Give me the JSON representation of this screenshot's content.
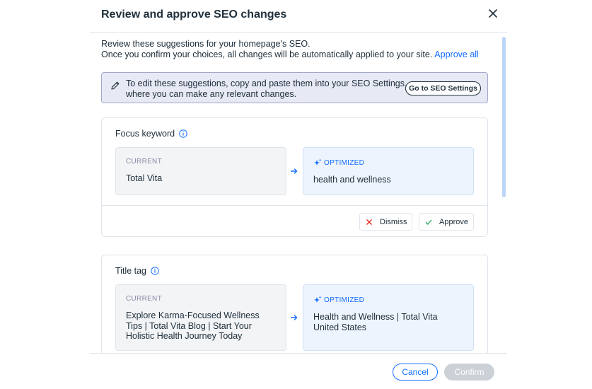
{
  "modal": {
    "title": "Review and approve SEO changes",
    "close_icon": "close-icon"
  },
  "intro": {
    "line1": "Review these suggestions for your homepage's SEO.",
    "line2": "Once you confirm your choices, all changes will be automatically applied to your site.",
    "approve_all": "Approve all"
  },
  "banner": {
    "icon": "pencil-icon",
    "text": "To edit these suggestions, copy and paste them into your SEO Settings, where you can make any relevant changes.",
    "button": "Go to SEO Settings"
  },
  "suggestions": [
    {
      "title": "Focus keyword",
      "current_label": "CURRENT",
      "current_value": "Total Vita",
      "optimized_label": "OPTIMIZED",
      "optimized_value": "health and wellness",
      "dismiss": "Dismiss",
      "approve": "Approve"
    },
    {
      "title": "Title tag",
      "current_label": "CURRENT",
      "current_value": "Explore Karma-Focused Wellness Tips | Total Vita Blog | Start Your Holistic Health Journey Today",
      "optimized_label": "OPTIMIZED",
      "optimized_value": "Health and Wellness | Total Vita United States"
    }
  ],
  "footer": {
    "cancel": "Cancel",
    "confirm": "Confirm"
  },
  "colors": {
    "accent": "#116dff",
    "banner_bg": "#e7e9f5",
    "dismiss_icon": "#e62214",
    "approve_icon": "#25a55a",
    "disabled": "#cbd1d6"
  }
}
